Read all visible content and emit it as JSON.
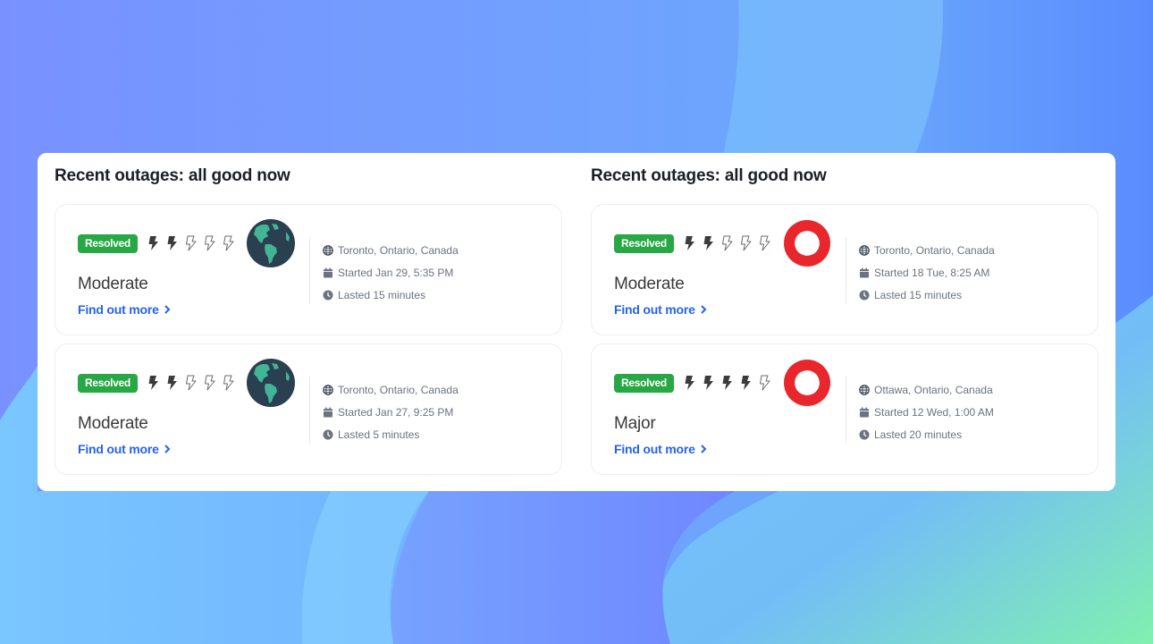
{
  "colors": {
    "badge": "#28a745",
    "link": "#2563eb",
    "bolt_filled": "#3c3c3c",
    "bolt_outline": "#6b6b6b",
    "globe_ocean": "#2a3f4f",
    "globe_land": "#43b597",
    "ring_logo": "#e8262b"
  },
  "columns": [
    {
      "title": "Recent outages: all good now",
      "cards": [
        {
          "badge": "Resolved",
          "severity_level": 2,
          "severity_max": 5,
          "logo": "globe-icon",
          "severity": "Moderate",
          "link": "Find out more",
          "location": "Toronto, Ontario, Canada",
          "started": "Started Jan 29, 5:35 PM",
          "lasted": "Lasted 15 minutes"
        },
        {
          "badge": "Resolved",
          "severity_level": 2,
          "severity_max": 5,
          "logo": "globe-icon",
          "severity": "Moderate",
          "link": "Find out more",
          "location": "Toronto, Ontario, Canada",
          "started": "Started Jan 27, 9:25 PM",
          "lasted": "Lasted 5 minutes"
        }
      ]
    },
    {
      "title": "Recent outages: all good now",
      "cards": [
        {
          "badge": "Resolved",
          "severity_level": 2,
          "severity_max": 5,
          "logo": "rogers-logo-icon",
          "severity": "Moderate",
          "link": "Find out more",
          "location": "Toronto, Ontario, Canada",
          "started": "Started 18 Tue, 8:25 AM",
          "lasted": "Lasted 15 minutes"
        },
        {
          "badge": "Resolved",
          "severity_level": 4,
          "severity_max": 5,
          "logo": "rogers-logo-icon",
          "severity": "Major",
          "link": "Find out more",
          "location": "Ottawa, Ontario, Canada",
          "started": "Started 12 Wed, 1:00 AM",
          "lasted": "Lasted 20 minutes"
        }
      ]
    }
  ]
}
